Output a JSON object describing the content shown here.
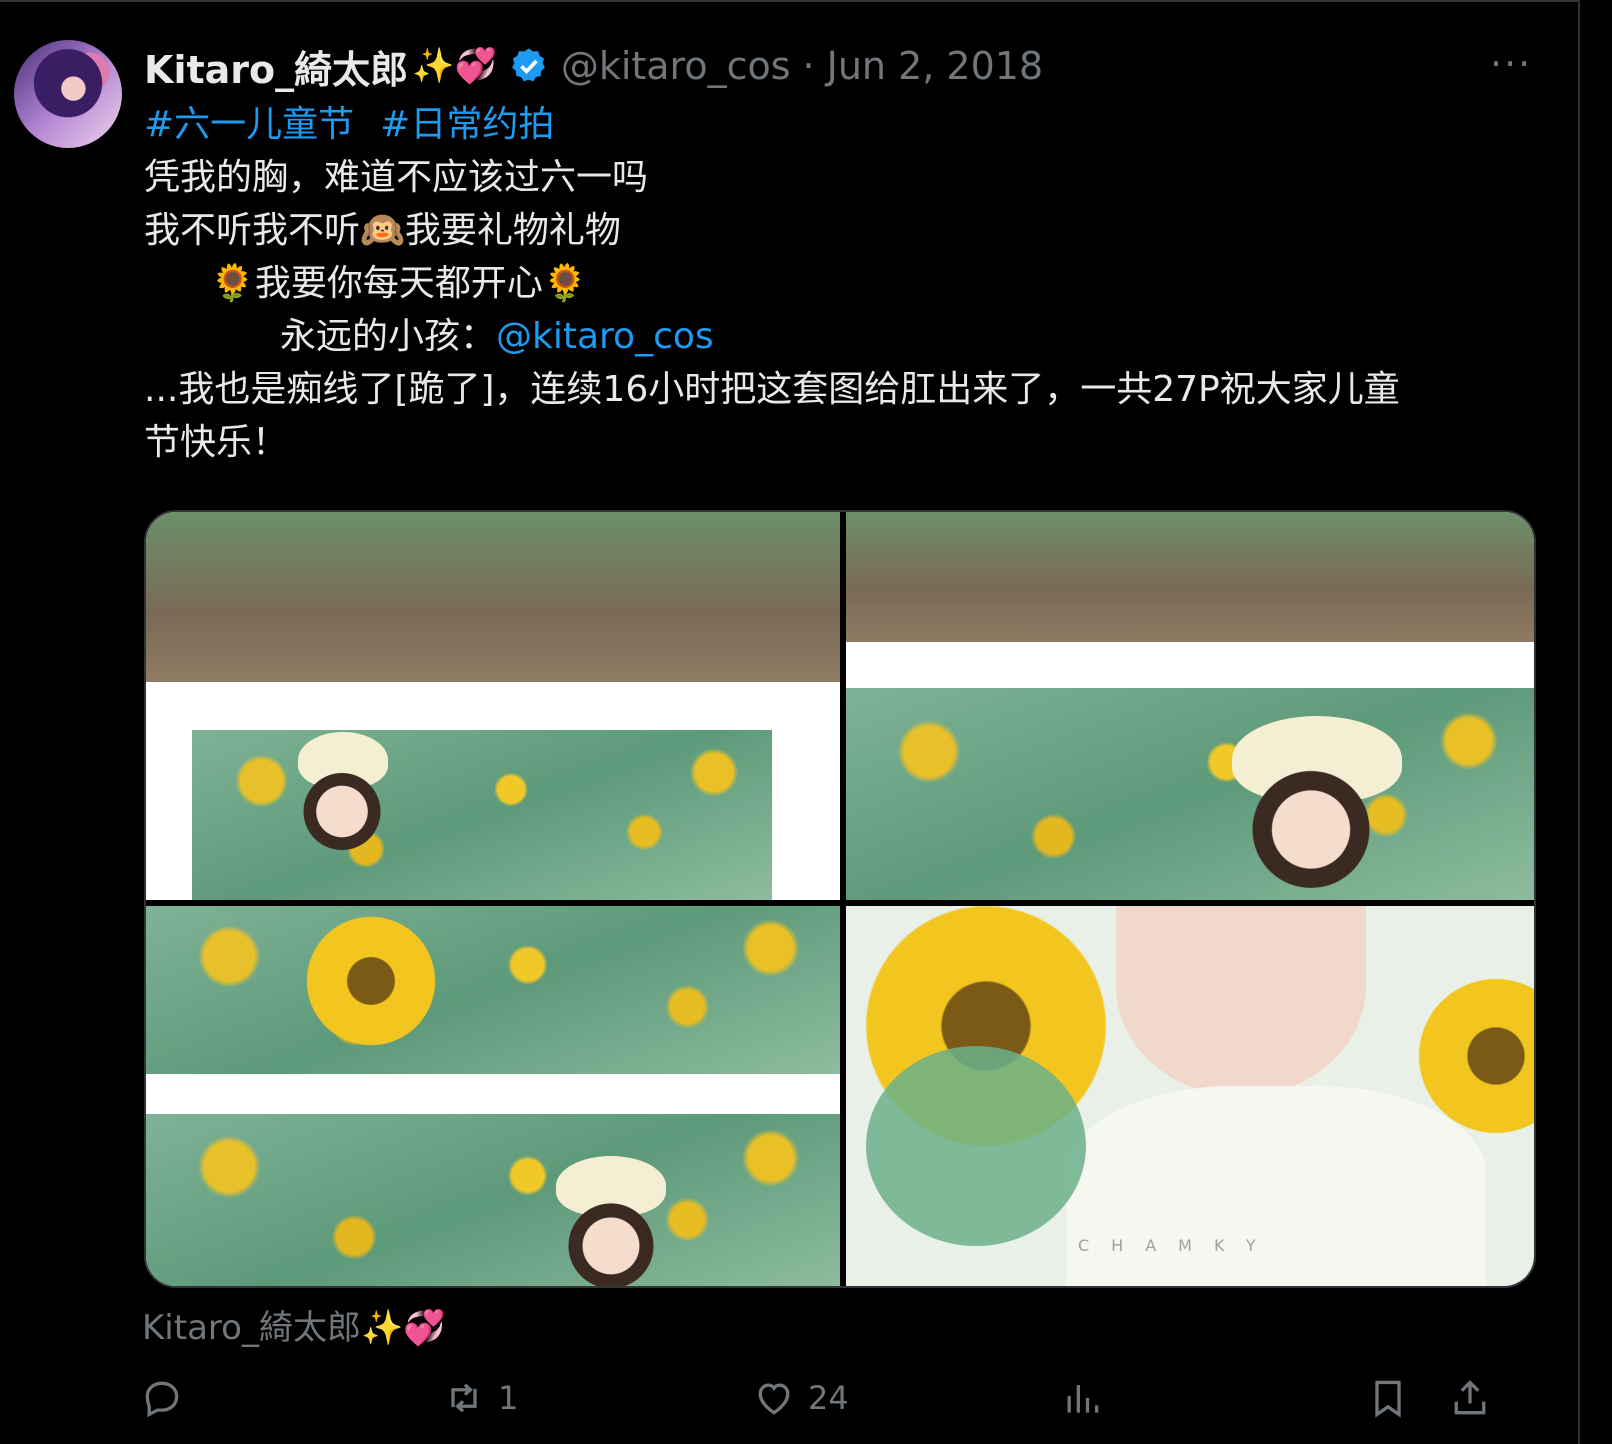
{
  "tweet": {
    "display_name": "Kitaro_綺太郎",
    "name_emoji": "✨💞",
    "handle": "@kitaro_cos",
    "separator": "·",
    "date": "Jun 2, 2018",
    "more": "···",
    "hashtags": [
      "#六一儿童节",
      "#日常约拍"
    ],
    "lines": [
      "凭我的胸，难道不应该过六一吗",
      "我不听我不听🙉我要礼物礼物",
      "🌻我要你每天都开心🌻"
    ],
    "line4_prefix": "永远的小孩：",
    "line4_mention": "@kitaro_cos",
    "line5": "...我也是痴线了[跪了]，连续16小时把这套图给肛出来了，一共27P祝大家儿童",
    "line6": "节快乐！",
    "watermark": "CHAMKY",
    "caption": "Kitaro_綺太郎✨💞"
  },
  "actions": {
    "reply_count": "",
    "retweet_count": "1",
    "like_count": "24",
    "views_count": ""
  },
  "colors": {
    "background": "#000000",
    "text": "#e7e9ea",
    "muted": "#71767b",
    "link": "#1d9bf0",
    "verified": "#1d9bf0"
  },
  "icons": [
    "reply-icon",
    "retweet-icon",
    "like-icon",
    "views-icon",
    "bookmark-icon",
    "share-icon",
    "verified-badge-icon",
    "more-icon"
  ]
}
